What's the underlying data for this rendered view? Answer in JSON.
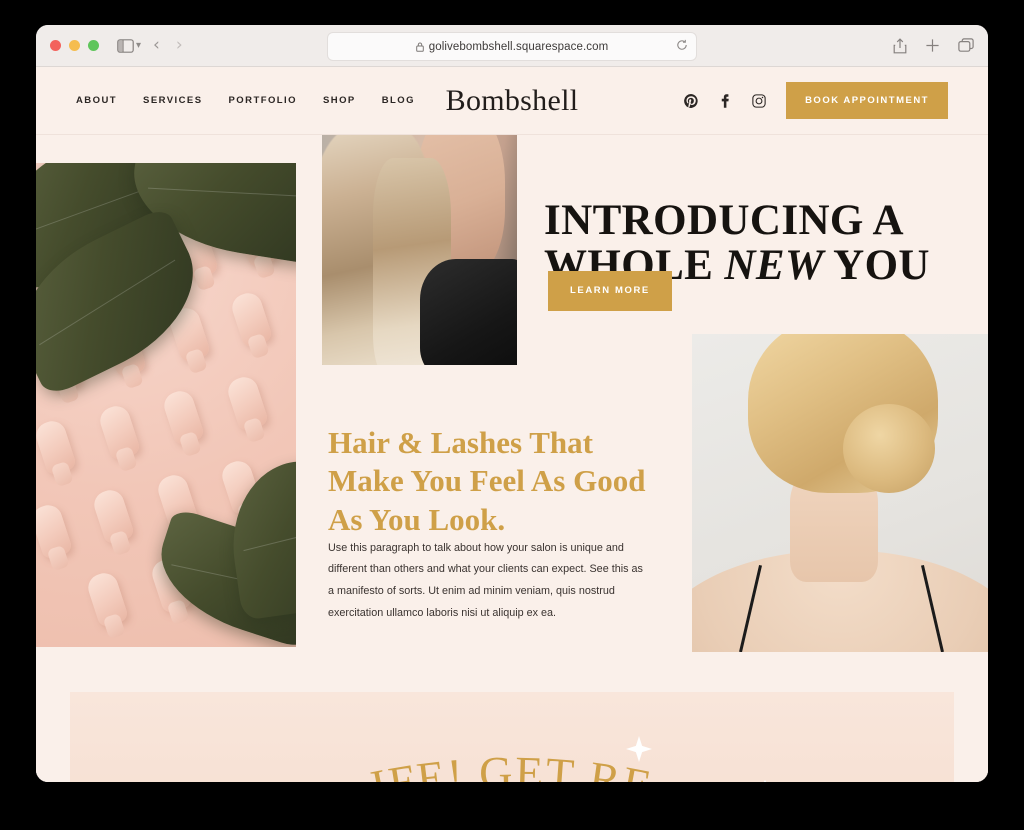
{
  "browser": {
    "url": "golivebombshell.squarespace.com",
    "lock_icon": "lock-icon",
    "reload_icon": "reload-icon",
    "sidebar_icon": "sidebar-toggle-icon",
    "sidebar_caret_icon": "chevron-down-icon",
    "back_icon": "back-chevron-icon",
    "forward_icon": "forward-chevron-icon",
    "share_icon": "share-icon",
    "new_tab_icon": "plus-icon",
    "tabs_icon": "tab-overview-icon",
    "traffic_lights": [
      "close-red",
      "minimize-yellow",
      "zoom-green"
    ]
  },
  "site": {
    "brand": "Bombshell",
    "nav": [
      {
        "label": "ABOUT",
        "name": "nav-item-about"
      },
      {
        "label": "SERVICES",
        "name": "nav-item-services"
      },
      {
        "label": "PORTFOLIO",
        "name": "nav-item-portfolio"
      },
      {
        "label": "SHOP",
        "name": "nav-item-shop"
      },
      {
        "label": "BLOG",
        "name": "nav-item-blog"
      }
    ],
    "social": [
      {
        "name": "pinterest-icon",
        "label": "Pinterest"
      },
      {
        "name": "facebook-icon",
        "label": "Facebook"
      },
      {
        "name": "instagram-icon",
        "label": "Instagram"
      }
    ],
    "book_button": "BOOK APPOINTMENT"
  },
  "hero": {
    "headline_line1": "INTRODUCING A",
    "headline_line2_pre": "WHOLE ",
    "headline_line2_em": "NEW",
    "headline_line2_post": " YOU",
    "learn_more": "LEARN MORE",
    "image_model_alt": "blonde-model-long-hair-leather-jacket",
    "image_dryers_alt": "pink-hair-dryer-wall-with-banana-leaves"
  },
  "intro": {
    "subhead": "Hair & Lashes That Make You Feel As Good As You Look.",
    "paragraph": "Use this paragraph to talk about how your salon is unique and different than others and what your clients can expect. See this as a manifesto of sorts. Ut enim ad minim veniam, quis nostrud exercitation ullamco laboris nisi ut aliquip ex ea.",
    "image_updo_alt": "blonde-woman-updo-bun-from-behind"
  },
  "bottom_band": {
    "curved_text": "IFE! GET RE",
    "star_icon": "four-point-star-icon"
  },
  "colors": {
    "gold": "#cfa048",
    "page_bg": "#faf0ea",
    "band_bg": "#f7e2d6",
    "ink": "#211d1b"
  }
}
